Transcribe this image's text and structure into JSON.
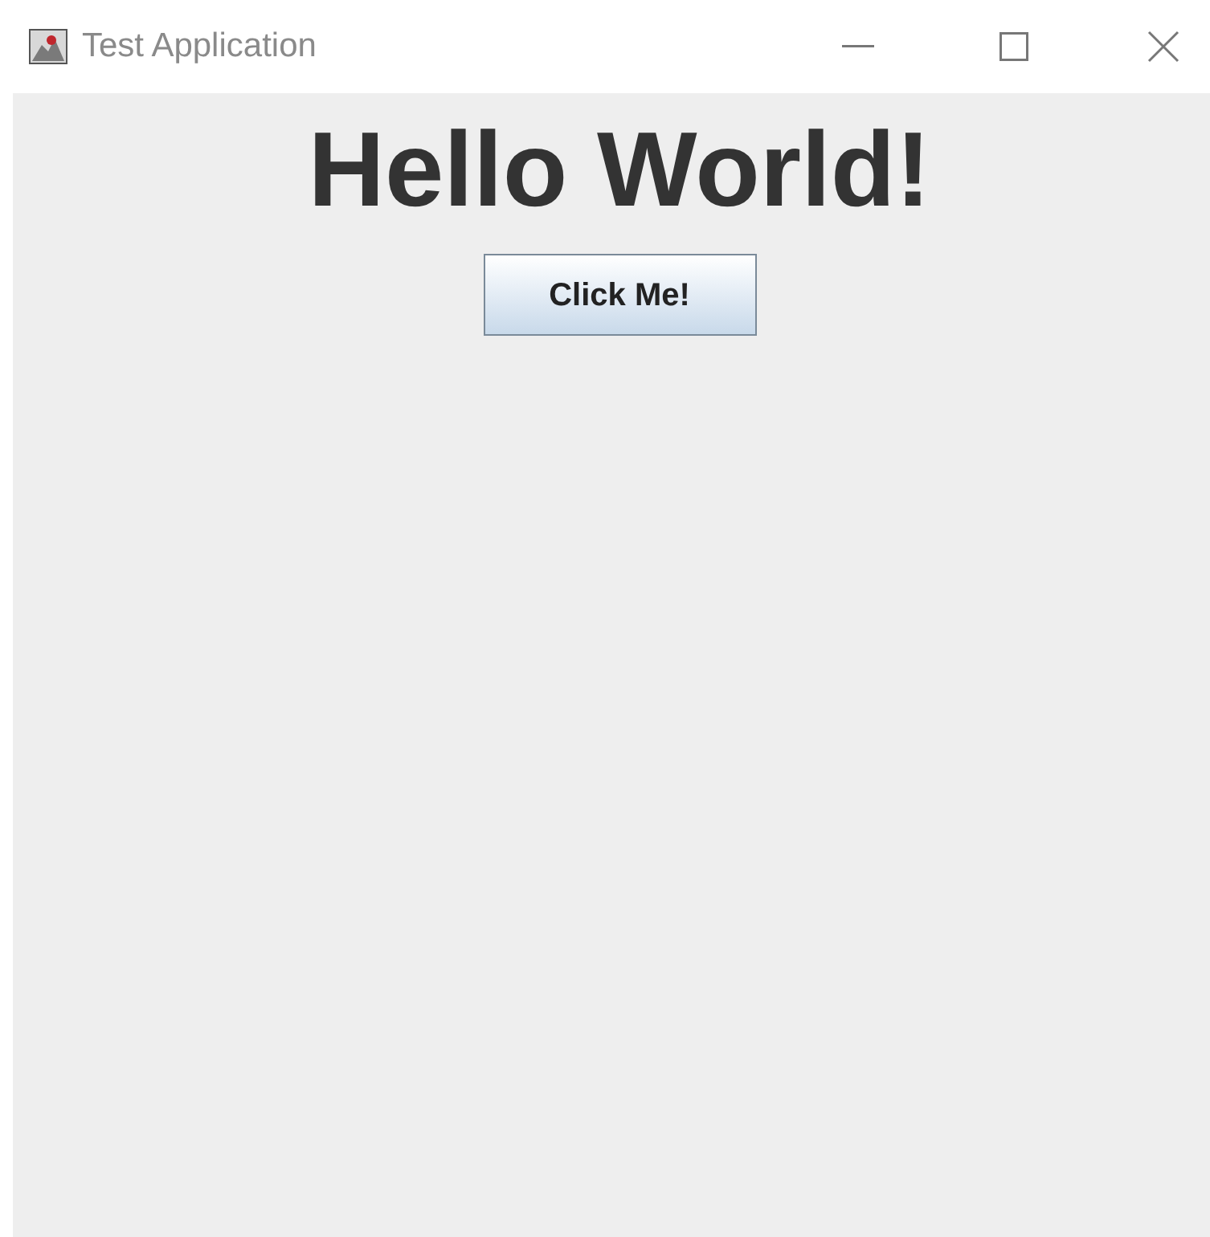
{
  "window": {
    "title": "Test Application"
  },
  "heading": "Hello World!",
  "button": {
    "label": "Click Me!"
  }
}
